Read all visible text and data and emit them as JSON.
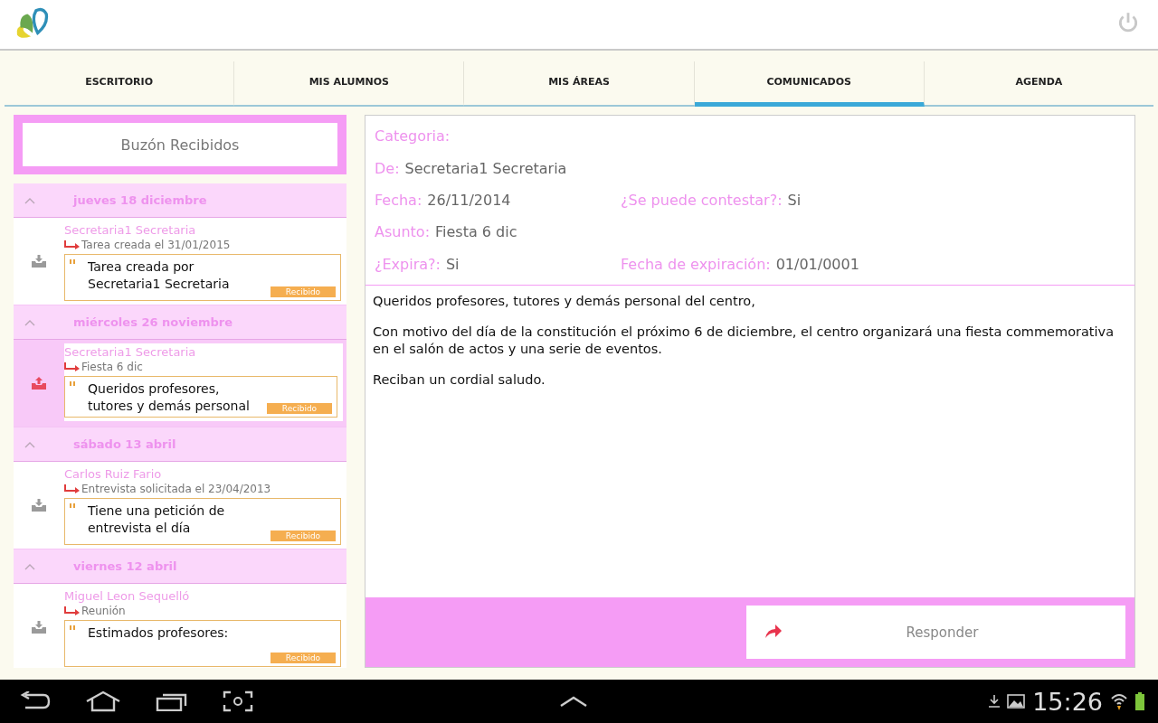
{
  "tabs": [
    {
      "label": "ESCRITORIO",
      "selected": false
    },
    {
      "label": "MIS ALUMNOS",
      "selected": false
    },
    {
      "label": "MIS ÁREAS",
      "selected": false
    },
    {
      "label": "COMUNICADOS",
      "selected": true
    },
    {
      "label": "AGENDA",
      "selected": false
    }
  ],
  "inbox": {
    "title": "Buzón Recibidos",
    "groups": [
      {
        "date": "jueves 18 diciembre",
        "expanded": true,
        "messages": [
          {
            "sender": "Secretaria1 Secretaria",
            "subject": "Tarea creada el 31/01/2015",
            "preview": "Tarea creada por Secretaria1 Secretaria",
            "status": "Recibido",
            "selected": false
          }
        ]
      },
      {
        "date": "miércoles 26 noviembre",
        "expanded": true,
        "messages": [
          {
            "sender": "Secretaria1 Secretaria",
            "subject": "Fiesta 6 dic",
            "preview": "Queridos profesores, tutores y demás personal",
            "status": "Recibido",
            "selected": true
          }
        ]
      },
      {
        "date": "sábado 13 abril",
        "expanded": true,
        "messages": [
          {
            "sender": "Carlos Ruiz Fario",
            "subject": "Entrevista solicitada el 23/04/2013",
            "preview": "Tiene una petición de entrevista el día",
            "status": "Recibido",
            "selected": false
          }
        ]
      },
      {
        "date": "viernes 12 abril",
        "expanded": true,
        "messages": [
          {
            "sender": "Miguel Leon Sequelló",
            "subject": "Reunión",
            "preview": "Estimados profesores:",
            "status": "Recibido",
            "selected": false
          }
        ]
      }
    ]
  },
  "detail": {
    "rows": [
      [
        {
          "label": "Categoria:"
        }
      ],
      [
        {
          "label": "De:",
          "value": "Secretaria1 Secretaria"
        }
      ],
      [
        {
          "label": "Fecha:",
          "value": "26/11/2014"
        },
        {
          "label": "¿Se puede contestar?:",
          "value": "Si"
        }
      ],
      [
        {
          "label": "Asunto:",
          "value": "Fiesta 6 dic"
        }
      ],
      [
        {
          "label": "¿Expira?:",
          "value": "Si"
        },
        {
          "label": "Fecha de expiración:",
          "value": "01/01/0001"
        }
      ]
    ],
    "body": [
      "Queridos profesores, tutores y demás personal del centro,",
      "Con motivo del día de la constitución el próximo 6 de diciembre, el centro organizará una fiesta commemorativa en el salón de actos y una serie de eventos.",
      "Reciban un cordial saludo."
    ],
    "reply_button": "Responder"
  },
  "status_bar": {
    "time": "15:26"
  }
}
